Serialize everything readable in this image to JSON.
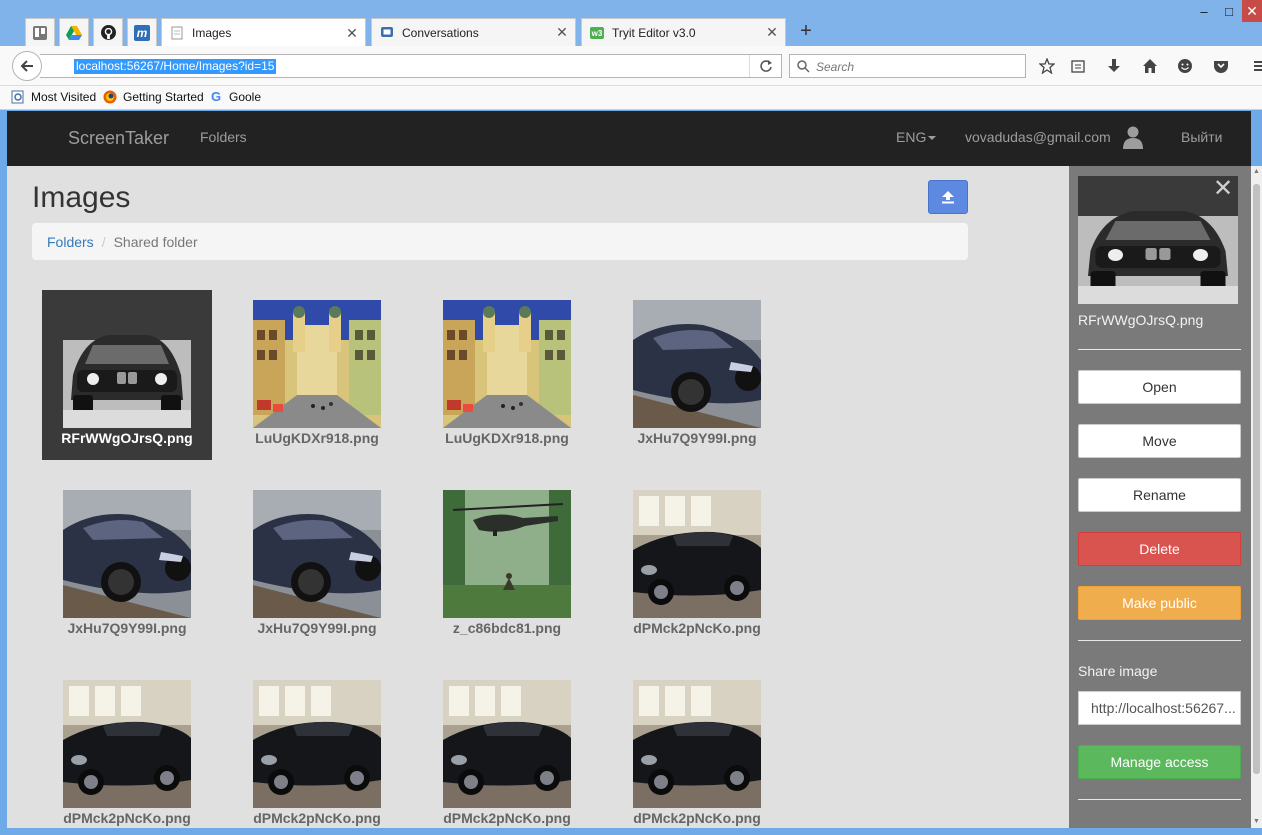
{
  "browser": {
    "tabs": [
      {
        "title": "Images",
        "close": "✕",
        "active": true
      },
      {
        "title": "Conversations",
        "close": "✕",
        "active": false
      },
      {
        "title": "Tryit Editor v3.0",
        "close": "✕",
        "active": false
      }
    ],
    "pinned_icons": [
      "trello-icon",
      "drive-icon",
      "github-icon",
      "m-icon"
    ],
    "pinned_m_label": "m",
    "new_tab": "+",
    "window_controls": {
      "minimize": "–",
      "maximize": "□",
      "close": "✕"
    },
    "url": "localhost:56267/Home/Images?id=15",
    "search_placeholder": "Search",
    "bookmarks": [
      {
        "label": "Most Visited",
        "icon": "most-visited-icon"
      },
      {
        "label": "Getting Started",
        "icon": "firefox-icon"
      },
      {
        "label": "Goole",
        "icon": "google-icon"
      }
    ],
    "google_letter": "G"
  },
  "app": {
    "brand": "ScreenTaker",
    "nav_folders": "Folders",
    "lang": "ENG",
    "user_email": "vovadudas@gmail.com",
    "logout": "Выйти",
    "page_title": "Images",
    "breadcrumb": {
      "root": "Folders",
      "separator": "/",
      "current": "Shared folder"
    },
    "images": [
      {
        "name": "RFrWWgOJrsQ.png",
        "kind": "bmw-x5-bw",
        "selected": true
      },
      {
        "name": "LuUgKDXr918.png",
        "kind": "street-church",
        "selected": false
      },
      {
        "name": "LuUgKDXr918.png",
        "kind": "street-church",
        "selected": false
      },
      {
        "name": "JxHu7Q9Y99I.png",
        "kind": "bmw-m3",
        "selected": false
      },
      {
        "name": "JxHu7Q9Y99I.png",
        "kind": "bmw-m3",
        "selected": false
      },
      {
        "name": "JxHu7Q9Y99I.png",
        "kind": "bmw-m3",
        "selected": false
      },
      {
        "name": "z_c86bdc81.png",
        "kind": "helicopter",
        "selected": false
      },
      {
        "name": "dPMck2pNcKo.png",
        "kind": "bmw-z4",
        "selected": false
      },
      {
        "name": "dPMck2pNcKo.png",
        "kind": "bmw-z4",
        "selected": false
      },
      {
        "name": "dPMck2pNcKo.png",
        "kind": "bmw-z4",
        "selected": false
      },
      {
        "name": "dPMck2pNcKo.png",
        "kind": "bmw-z4",
        "selected": false
      },
      {
        "name": "dPMck2pNcKo.png",
        "kind": "bmw-z4",
        "selected": false
      }
    ]
  },
  "sidepanel": {
    "close": "✕",
    "filename": "RFrWWgOJrsQ.png",
    "open": "Open",
    "move": "Move",
    "rename": "Rename",
    "delete": "Delete",
    "make_public": "Make public",
    "share_label": "Share image",
    "share_url": "http://localhost:56267...",
    "manage_access": "Manage access"
  },
  "colors": {
    "navbar": "#222222",
    "delete": "#d9534f",
    "make_public": "#f0ad4e",
    "manage_access": "#5cb85c",
    "upload": "#5d89e0",
    "link": "#337ab7"
  }
}
